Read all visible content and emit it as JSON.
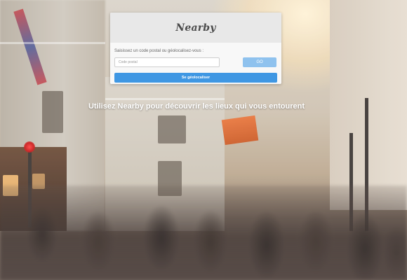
{
  "brand": {
    "name": "Nearby"
  },
  "search": {
    "prompt": "Saisissez un code postal ou géolocalisez-vous :",
    "postal_placeholder": "Code postal",
    "postal_value": "",
    "go_label": "GO",
    "geolocate_label": "Se géolocaliser"
  },
  "tagline": "Utilisez Nearby pour découvrir les lieux qui vous entourent",
  "colors": {
    "card_header": "#e8e8e8",
    "go_button": "#8fc2ee",
    "geolocate_button": "#3f97e3",
    "tagline": "#ffffff"
  },
  "background": {
    "type": "blurred-city-street-photo"
  }
}
